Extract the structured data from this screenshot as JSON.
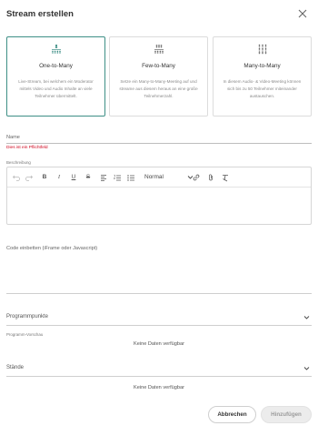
{
  "dialog": {
    "title": "Stream erstellen"
  },
  "cards": [
    {
      "title": "One-to-Many",
      "description": "Live-Stream, bei welchem ein Moderator mittels Video und Audio Inhalte an viele Teilnehmer übermittelt.",
      "icon": "one-to-many-icon"
    },
    {
      "title": "Few-to-Many",
      "description": "Setze ein Many-to-Many-Meeting auf und streame aus diesem heraus an eine große Teilnehmerzahl.",
      "icon": "few-to-many-icon"
    },
    {
      "title": "Many-to-Many",
      "description": "In diesem Audio- & Video-Meeting können sich bis zu 50 Teilnehmer miteinander austauschen.",
      "icon": "many-to-many-icon"
    }
  ],
  "name_field": {
    "label": "Name",
    "value": "",
    "error": "Dies ist ein Pflichtfeld"
  },
  "description_field": {
    "label": "Beschreibung",
    "format": "Normal",
    "toolbar": [
      "undo-icon",
      "redo-icon",
      "bold-icon",
      "italic-icon",
      "underline-icon",
      "strikethrough-icon",
      "align-left-icon",
      "ordered-list-icon",
      "bullet-list-icon",
      "link-icon",
      "attachment-icon",
      "clear-format-icon"
    ]
  },
  "code_field": {
    "label": "Code einbetten (iFrame oder Javascript)"
  },
  "program_points": {
    "label": "Programmpunkte",
    "preview_label": "Programm-Vorschau",
    "empty": "Keine Daten verfügbar"
  },
  "booths": {
    "label": "Stände",
    "empty": "Keine Daten verfügbar"
  },
  "actions": {
    "cancel": "Abbrechen",
    "add": "Hinzufügen"
  },
  "colors": {
    "accent": "#3e8f86",
    "error": "#d0021b",
    "disabled_bg": "#ececec"
  }
}
